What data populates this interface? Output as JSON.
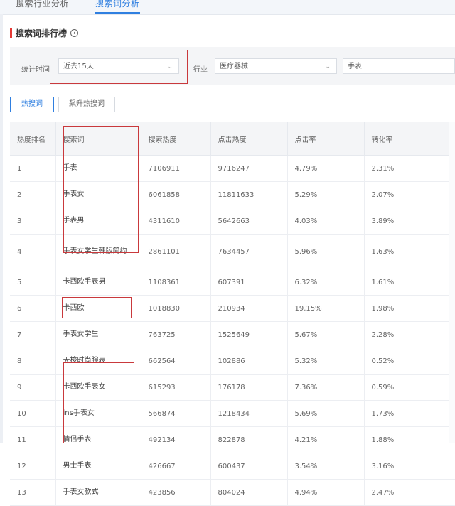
{
  "top_tabs": [
    {
      "label": "搜索行业分析",
      "active": false
    },
    {
      "label": "搜索词分析",
      "active": true
    }
  ],
  "section": {
    "title": "搜索词排行榜",
    "help_icon": "question-circle-icon"
  },
  "filters": {
    "time_label": "统计时间",
    "time_value": "近去15天",
    "industry_label": "行业",
    "industry_value": "医疗器械",
    "keyword_value": "手表"
  },
  "buttons": {
    "hot": "热搜词",
    "rising": "飙升热搜词"
  },
  "table": {
    "headers": [
      "热度排名",
      "搜索词",
      "搜索热度",
      "点击热度",
      "点击率",
      "转化率"
    ],
    "rows": [
      {
        "rank": "1",
        "keyword": "手表",
        "search": "7106911",
        "click": "9716247",
        "ctr": "4.79%",
        "cvr": "2.31%"
      },
      {
        "rank": "2",
        "keyword": "手表女",
        "search": "6061858",
        "click": "11811633",
        "ctr": "5.29%",
        "cvr": "2.07%"
      },
      {
        "rank": "3",
        "keyword": "手表男",
        "search": "4311610",
        "click": "5642663",
        "ctr": "4.03%",
        "cvr": "3.89%"
      },
      {
        "rank": "4",
        "keyword": "手表女学生韩版简约",
        "search": "2861101",
        "click": "7634457",
        "ctr": "5.96%",
        "cvr": "1.63%"
      },
      {
        "rank": "5",
        "keyword": "卡西欧手表男",
        "search": "1108361",
        "click": "607391",
        "ctr": "6.32%",
        "cvr": "1.61%"
      },
      {
        "rank": "6",
        "keyword": "卡西欧",
        "search": "1018830",
        "click": "210934",
        "ctr": "19.15%",
        "cvr": "1.98%"
      },
      {
        "rank": "7",
        "keyword": "手表女学生",
        "search": "763725",
        "click": "1525649",
        "ctr": "5.67%",
        "cvr": "2.28%"
      },
      {
        "rank": "8",
        "keyword": "天梭时尚腕表",
        "search": "662564",
        "click": "102886",
        "ctr": "5.32%",
        "cvr": "0.52%"
      },
      {
        "rank": "9",
        "keyword": "卡西欧手表女",
        "search": "615293",
        "click": "176178",
        "ctr": "7.36%",
        "cvr": "0.59%"
      },
      {
        "rank": "10",
        "keyword": "ins手表女",
        "search": "566874",
        "click": "1218434",
        "ctr": "5.69%",
        "cvr": "1.73%"
      },
      {
        "rank": "11",
        "keyword": "情侣手表",
        "search": "492134",
        "click": "822878",
        "ctr": "4.21%",
        "cvr": "1.88%"
      },
      {
        "rank": "12",
        "keyword": "男士手表",
        "search": "426667",
        "click": "600437",
        "ctr": "3.54%",
        "cvr": "3.16%"
      },
      {
        "rank": "13",
        "keyword": "手表女款式",
        "search": "423856",
        "click": "804024",
        "ctr": "4.94%",
        "cvr": "2.47%"
      }
    ]
  },
  "colors": {
    "accent": "#2f7fe0",
    "highlight_box": "#c9393c",
    "title_bar": "#e53935"
  }
}
